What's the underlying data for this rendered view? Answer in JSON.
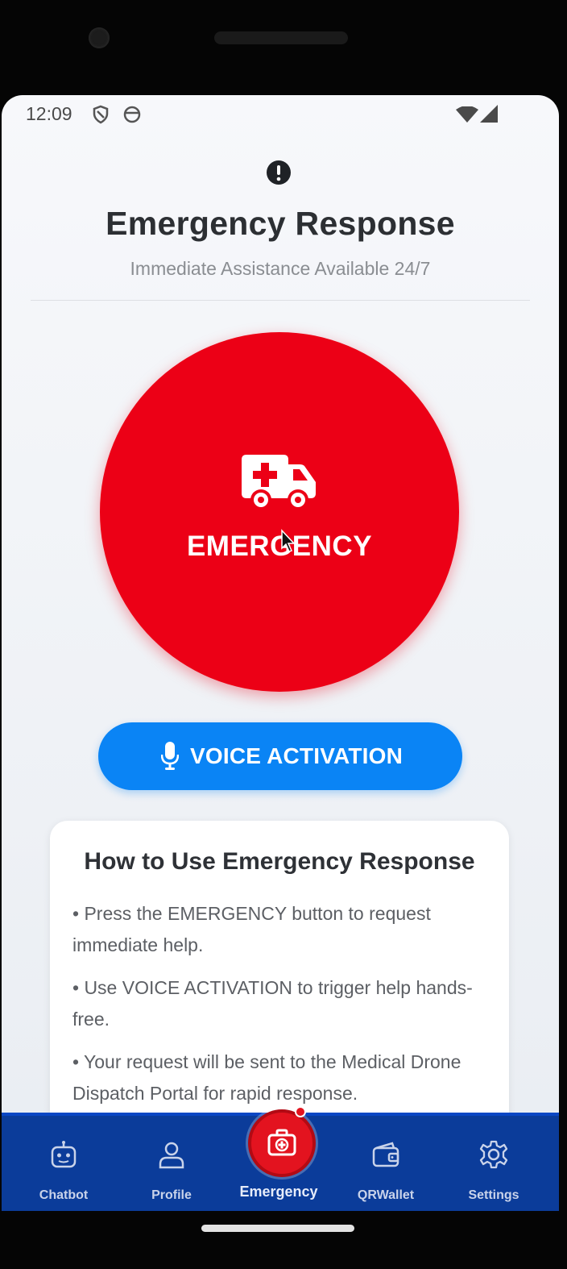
{
  "status_bar": {
    "time": "12:09",
    "icons": [
      "shield-icon",
      "sync-icon",
      "wifi-icon",
      "signal-icon"
    ]
  },
  "header": {
    "alert_icon": "exclamation-circle-icon",
    "title": "Emergency Response",
    "subtitle": "Immediate Assistance Available 24/7"
  },
  "emergency_button": {
    "icon": "ambulance-icon",
    "label": "EMERGENCY",
    "color": "#ec0016"
  },
  "voice_button": {
    "icon": "microphone-icon",
    "label": "VOICE ACTIVATION",
    "color": "#0a84f5"
  },
  "info_card": {
    "title": "How to Use Emergency Response",
    "bullets": [
      "• Press the EMERGENCY button to request immediate help.",
      "• Use VOICE ACTIVATION to trigger help hands-free.",
      "• Your request will be sent to the Medical Drone Dispatch Portal for rapid response."
    ]
  },
  "bottom_nav": {
    "color": "#0b3c9a",
    "items": [
      {
        "label": "Chatbot",
        "icon": "robot-icon"
      },
      {
        "label": "Profile",
        "icon": "user-icon"
      },
      {
        "label": "Emergency",
        "icon": "medical-kit-icon",
        "active": true
      },
      {
        "label": "QRWallet",
        "icon": "wallet-icon"
      },
      {
        "label": "Settings",
        "icon": "gear-icon"
      }
    ]
  }
}
